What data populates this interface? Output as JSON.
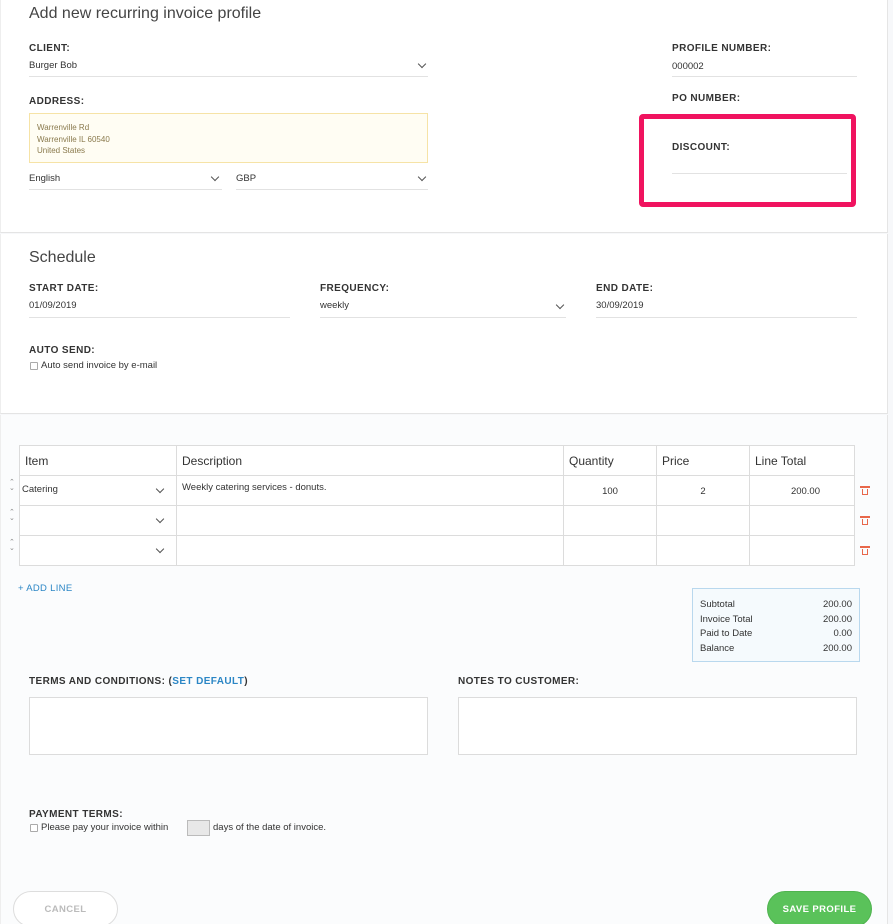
{
  "page": {
    "title": "Add new recurring invoice profile"
  },
  "client": {
    "label": "CLIENT:",
    "value": "Burger Bob"
  },
  "address": {
    "label": "ADDRESS:",
    "lines": [
      "Warrenville Rd",
      "Warrenville IL 60540",
      "United States"
    ]
  },
  "language": {
    "value": "English"
  },
  "currency": {
    "value": "GBP"
  },
  "profile_number": {
    "label": "PROFILE NUMBER:",
    "value": "000002"
  },
  "po_number": {
    "label": "PO NUMBER:"
  },
  "discount": {
    "label": "DISCOUNT:",
    "value": ""
  },
  "schedule": {
    "title": "Schedule",
    "start_date": {
      "label": "START DATE:",
      "value": "01/09/2019"
    },
    "frequency": {
      "label": "FREQUENCY:",
      "value": "weekly"
    },
    "end_date": {
      "label": "END DATE:",
      "value": "30/09/2019"
    },
    "auto_send": {
      "label": "AUTO SEND:",
      "checkbox_label": "Auto send invoice by e-mail"
    }
  },
  "items_table": {
    "headers": [
      "Item",
      "Description",
      "Quantity",
      "Price",
      "Line Total"
    ],
    "rows": [
      {
        "item": "Catering",
        "description": "Weekly catering services - donuts.",
        "quantity": "100",
        "price": "2",
        "line_total": "200.00"
      },
      {
        "item": "",
        "description": "",
        "quantity": "",
        "price": "",
        "line_total": ""
      },
      {
        "item": "",
        "description": "",
        "quantity": "",
        "price": "",
        "line_total": ""
      }
    ],
    "add_line_label": "+ ADD LINE"
  },
  "totals": {
    "subtotal_label": "Subtotal",
    "subtotal": "200.00",
    "invoice_total_label": "Invoice Total",
    "invoice_total": "200.00",
    "paid_label": "Paid to Date",
    "paid": "0.00",
    "balance_label": "Balance",
    "balance": "200.00"
  },
  "terms": {
    "label": "TERMS AND CONDITIONS: ",
    "set_default_open": "(",
    "set_default_link": "SET DEFAULT",
    "set_default_close": ")"
  },
  "notes": {
    "label": "NOTES TO CUSTOMER:"
  },
  "payment_terms": {
    "label": "PAYMENT TERMS:",
    "text_before": "Please pay your invoice within",
    "text_after": "days of the date of invoice."
  },
  "actions": {
    "cancel": "CANCEL",
    "save": "SAVE PROFILE"
  },
  "colors": {
    "accent": "#2b86c5",
    "highlight": "#f0135f",
    "save_green": "#5ac25a",
    "delete_red": "#e8674a"
  }
}
